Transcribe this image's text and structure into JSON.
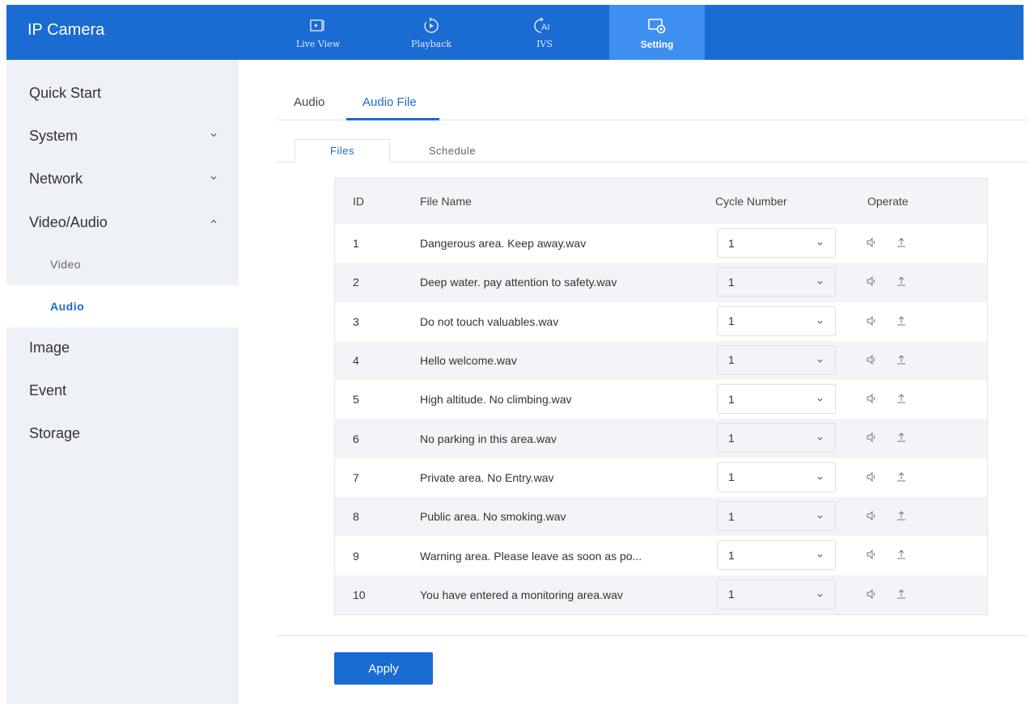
{
  "app_title": "IP Camera",
  "top_nav": [
    {
      "label": "Live View",
      "icon": "live-view-icon"
    },
    {
      "label": "Playback",
      "icon": "playback-icon"
    },
    {
      "label": "IVS",
      "icon": "ai-icon"
    },
    {
      "label": "Setting",
      "icon": "setting-icon",
      "active": true
    }
  ],
  "sidebar": {
    "items": [
      {
        "label": "Quick Start"
      },
      {
        "label": "System",
        "expanded": false
      },
      {
        "label": "Network",
        "expanded": false
      },
      {
        "label": "Video/Audio",
        "expanded": true
      },
      {
        "label": "Image"
      },
      {
        "label": "Event"
      },
      {
        "label": "Storage"
      }
    ],
    "sub_items": [
      {
        "label": "Video"
      },
      {
        "label": "Audio",
        "active": true
      }
    ]
  },
  "tabs": [
    {
      "label": "Audio"
    },
    {
      "label": "Audio File",
      "active": true
    }
  ],
  "sub_tabs": [
    {
      "label": "Files",
      "active": true
    },
    {
      "label": "Schedule"
    }
  ],
  "table": {
    "headers": {
      "id": "ID",
      "file_name": "File Name",
      "cycle_number": "Cycle Number",
      "operate": "Operate"
    },
    "rows": [
      {
        "id": "1",
        "name": "Dangerous area. Keep away.wav",
        "cycle": "1"
      },
      {
        "id": "2",
        "name": "Deep water. pay attention to safety.wav",
        "cycle": "1"
      },
      {
        "id": "3",
        "name": "Do not touch valuables.wav",
        "cycle": "1"
      },
      {
        "id": "4",
        "name": "Hello welcome.wav",
        "cycle": "1"
      },
      {
        "id": "5",
        "name": "High altitude. No climbing.wav",
        "cycle": "1"
      },
      {
        "id": "6",
        "name": "No parking in this area.wav",
        "cycle": "1"
      },
      {
        "id": "7",
        "name": "Private area. No Entry.wav",
        "cycle": "1"
      },
      {
        "id": "8",
        "name": "Public area. No smoking.wav",
        "cycle": "1"
      },
      {
        "id": "9",
        "name": "Warning area. Please leave as soon as po...",
        "cycle": "1"
      },
      {
        "id": "10",
        "name": "You have entered a monitoring area.wav",
        "cycle": "1"
      }
    ]
  },
  "apply_label": "Apply",
  "colors": {
    "brand": "#1a6bd2",
    "active_nav": "#3f8ff0",
    "sidebar_bg": "#eef1f6",
    "row_alt": "#f3f4f7"
  }
}
